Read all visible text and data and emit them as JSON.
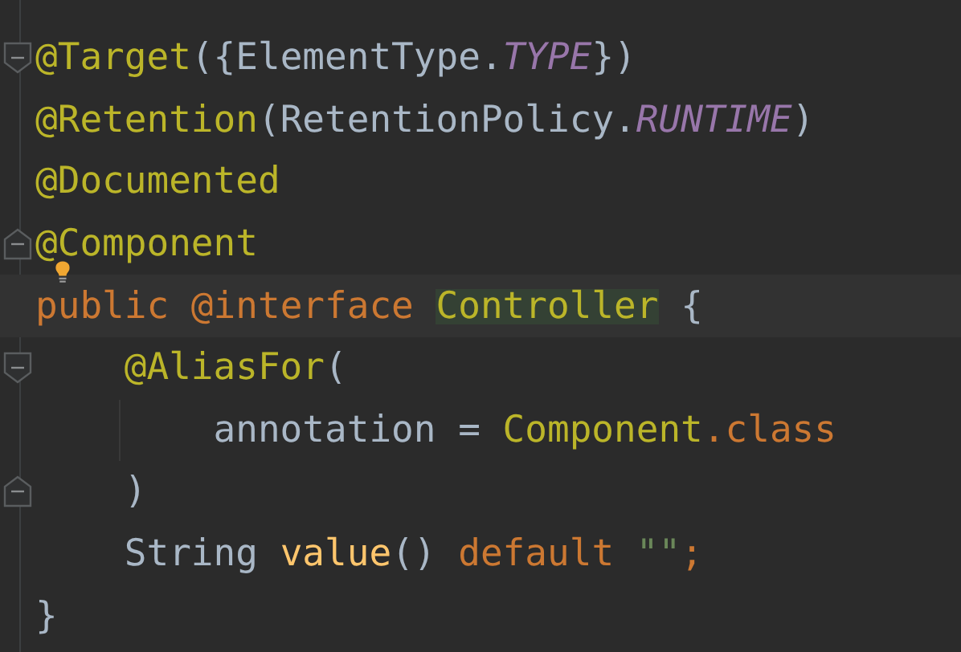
{
  "editor": {
    "lines": [
      {
        "fold_start": true,
        "fold_end": false,
        "bulb": false,
        "current": false,
        "tokens": [
          {
            "text": "@Target",
            "kind": "annotation"
          },
          {
            "text": "({ElementType.",
            "kind": "plain"
          },
          {
            "text": "TYPE",
            "kind": "constant"
          },
          {
            "text": "})",
            "kind": "plain"
          }
        ]
      },
      {
        "fold_start": false,
        "fold_end": false,
        "bulb": false,
        "current": false,
        "tokens": [
          {
            "text": "@Retention",
            "kind": "annotation"
          },
          {
            "text": "(RetentionPolicy.",
            "kind": "plain"
          },
          {
            "text": "RUNTIME",
            "kind": "constant"
          },
          {
            "text": ")",
            "kind": "plain"
          }
        ]
      },
      {
        "fold_start": false,
        "fold_end": false,
        "bulb": false,
        "current": false,
        "tokens": [
          {
            "text": "@Documented",
            "kind": "annotation"
          }
        ]
      },
      {
        "fold_start": false,
        "fold_end": true,
        "bulb": true,
        "current": false,
        "tokens": [
          {
            "text": "@Component",
            "kind": "annotation"
          }
        ]
      },
      {
        "fold_start": false,
        "fold_end": false,
        "bulb": false,
        "current": true,
        "tokens": [
          {
            "text": "public @interface ",
            "kind": "keyword"
          },
          {
            "text": "Controller",
            "kind": "match"
          },
          {
            "text": " {",
            "kind": "plain"
          }
        ],
        "children": [
          {
            "fold_start": true,
            "fold_end": false,
            "bulb": false,
            "current": false,
            "tokens": [
              {
                "text": "@AliasFor",
                "kind": "annotation"
              },
              {
                "text": "(",
                "kind": "plain"
              }
            ],
            "children": [
              {
                "fold_start": false,
                "fold_end": false,
                "bulb": false,
                "current": false,
                "tokens": [
                  {
                    "text": "annotation = ",
                    "kind": "plain"
                  },
                  {
                    "text": "Component",
                    "kind": "annotation"
                  },
                  {
                    "text": ".class",
                    "kind": "keyword"
                  }
                ]
              }
            ]
          },
          {
            "fold_start": false,
            "fold_end": true,
            "bulb": false,
            "current": false,
            "tokens": [
              {
                "text": ")",
                "kind": "plain"
              }
            ]
          },
          {
            "fold_start": false,
            "fold_end": false,
            "bulb": false,
            "current": false,
            "tokens": [
              {
                "text": "String ",
                "kind": "plain"
              },
              {
                "text": "value",
                "kind": "method"
              },
              {
                "text": "() ",
                "kind": "plain"
              },
              {
                "text": "default ",
                "kind": "keyword"
              },
              {
                "text": "\"\"",
                "kind": "string"
              },
              {
                "text": ";",
                "kind": "keyword"
              }
            ]
          }
        ]
      },
      {
        "fold_start": false,
        "fold_end": false,
        "bulb": false,
        "current": false,
        "tokens": [
          {
            "text": "}",
            "kind": "plain"
          }
        ]
      }
    ]
  }
}
